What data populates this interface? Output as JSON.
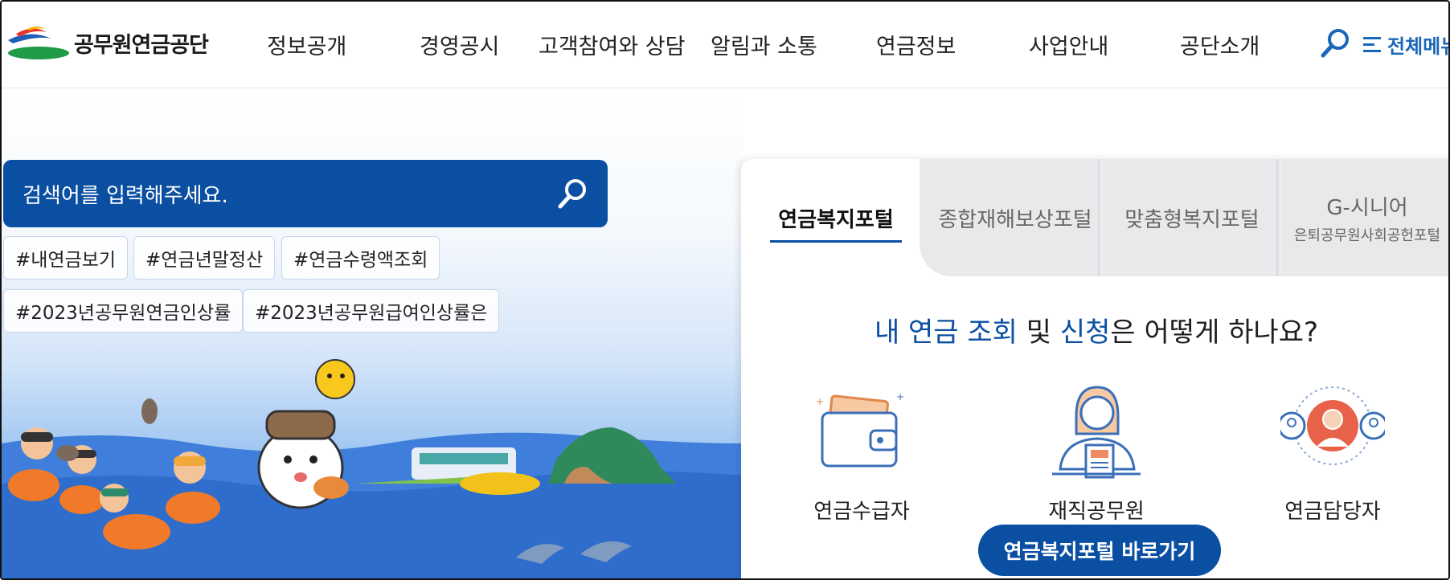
{
  "header": {
    "logo_text": "공무원연금공단",
    "nav": [
      "정보공개",
      "경영공시",
      "고객참여와 상담",
      "알림과 소통",
      "연금정보",
      "사업안내",
      "공단소개"
    ],
    "all_menu_label": "전체메뉴"
  },
  "search": {
    "placeholder": "검색어를 입력해주세요."
  },
  "tags": [
    "#내연금보기",
    "#연금년말정산",
    "#연금수령액조회",
    "#2023년공무원연금인상률",
    "#2023년공무원급여인상률은"
  ],
  "panel": {
    "tabs": [
      {
        "label": "연금복지포털"
      },
      {
        "label": "종합재해보상포털"
      },
      {
        "label": "맞춤형복지포털"
      },
      {
        "label": "G-시니어",
        "sub": "은퇴공무원사회공헌포털"
      }
    ],
    "question": {
      "part1": "내 연금 조회",
      "part2": " 및 ",
      "part3": "신청",
      "part4": "은 어떻게 하나요?"
    },
    "roles": [
      "연금수급자",
      "재직공무원",
      "연금담당자"
    ],
    "button_label": "연금복지포털 바로가기"
  },
  "colors": {
    "primary": "#0a4fa2",
    "accent": "#1a66b8",
    "tab_bg": "#e9e9ec"
  }
}
